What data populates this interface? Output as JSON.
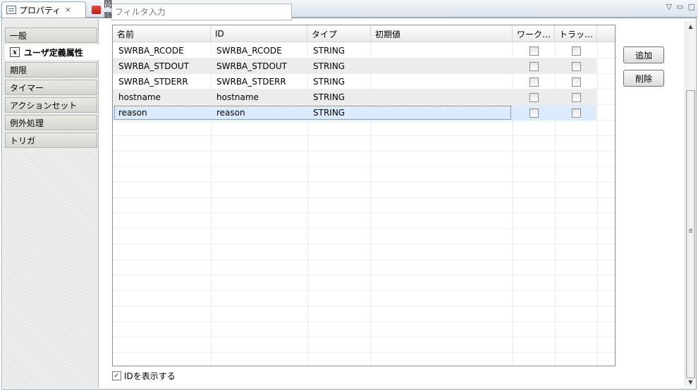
{
  "tabs": [
    {
      "label": "プロパティ",
      "icon": "properties-icon",
      "active": true,
      "close": "×"
    },
    {
      "label": "問題",
      "icon": "problems-icon",
      "active": false
    }
  ],
  "view_buttons": {
    "menu": "▽",
    "minimize": "▭",
    "maximize": "□"
  },
  "sidebar": {
    "items": [
      {
        "label": "一般"
      },
      {
        "label": "ユーザ定義属性",
        "selected": true,
        "icon": "x-variable-icon",
        "icon_glyph": "x"
      },
      {
        "label": "期限"
      },
      {
        "label": "タイマー"
      },
      {
        "label": "アクションセット"
      },
      {
        "label": "例外処理"
      },
      {
        "label": "トリガ"
      }
    ]
  },
  "filter": {
    "placeholder": "フィルタ入力"
  },
  "table": {
    "columns": [
      "名前",
      "ID",
      "タイプ",
      "初期値",
      "ワーク…",
      "トラッ…"
    ],
    "rows": [
      {
        "name": "SWRBA_RCODE",
        "id": "SWRBA_RCODE",
        "type": "STRING",
        "initial": "",
        "work": false,
        "track": false
      },
      {
        "name": "SWRBA_STDOUT",
        "id": "SWRBA_STDOUT",
        "type": "STRING",
        "initial": "",
        "work": false,
        "track": false
      },
      {
        "name": "SWRBA_STDERR",
        "id": "SWRBA_STDERR",
        "type": "STRING",
        "initial": "",
        "work": false,
        "track": false
      },
      {
        "name": "hostname",
        "id": "hostname",
        "type": "STRING",
        "initial": "",
        "work": false,
        "track": false
      },
      {
        "name": "reason",
        "id": "reason",
        "type": "STRING",
        "initial": "",
        "work": false,
        "track": false
      }
    ]
  },
  "buttons": {
    "add": "追加",
    "delete": "削除"
  },
  "show_id": {
    "label": "IDを表示する",
    "checked": true,
    "mark": "✓"
  },
  "scrollbar": {
    "up": "▲",
    "down": "▼"
  },
  "colors": {
    "selected_row": "#dcebfb",
    "alt_row": "#ececec",
    "frame": "#9aa7b8"
  }
}
